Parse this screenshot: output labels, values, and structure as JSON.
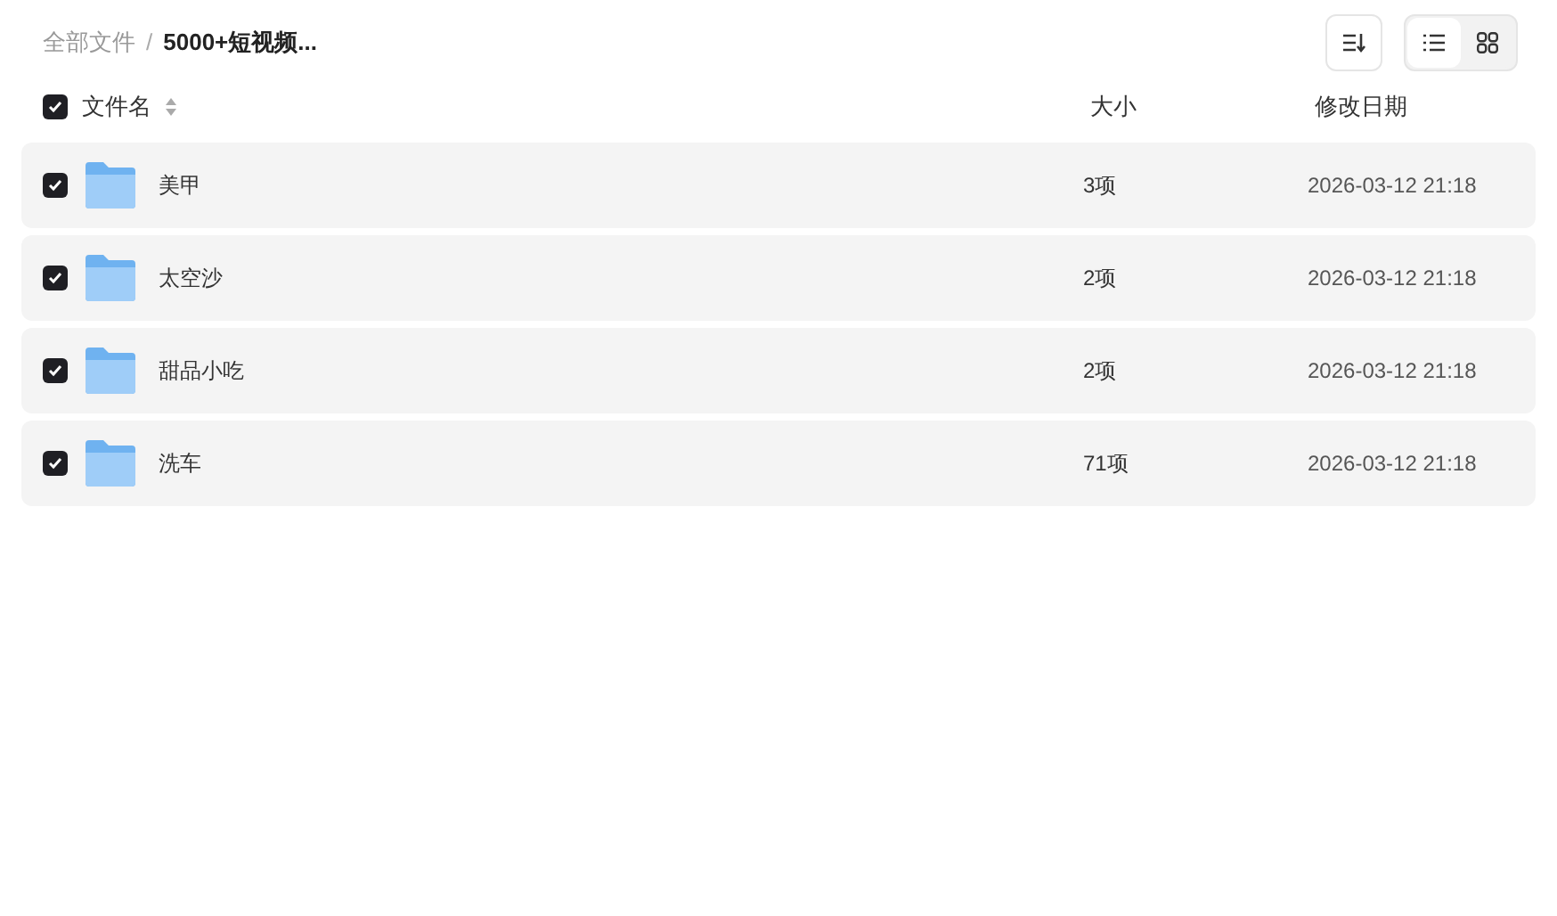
{
  "breadcrumb": [
    {
      "label": "全部文件",
      "current": false
    },
    {
      "label": "5000+短视频...",
      "current": true
    }
  ],
  "breadcrumb_separator": "/",
  "view_modes": [
    {
      "kind": "list",
      "selected": true
    },
    {
      "kind": "grid",
      "selected": false
    }
  ],
  "table": {
    "select_all": {
      "checked": true
    },
    "columns": [
      "文件名",
      "大小",
      "修改日期"
    ],
    "rows": [
      {
        "checked": true,
        "name": "美甲",
        "size": "3项",
        "modified": "2026-03-12 21:18"
      },
      {
        "checked": true,
        "name": "太空沙",
        "size": "2项",
        "modified": "2026-03-12 21:18"
      },
      {
        "checked": true,
        "name": "甜品小吃",
        "size": "2项",
        "modified": "2026-03-12 21:18"
      },
      {
        "checked": true,
        "name": "洗车",
        "size": "71项",
        "modified": "2026-03-12 21:18"
      }
    ]
  }
}
